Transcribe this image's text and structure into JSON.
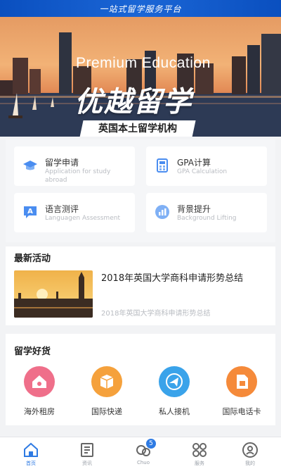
{
  "topbar": {
    "title": "一站式留学服务平台"
  },
  "hero": {
    "english_title": "Premium Education",
    "chinese_title": "优越留学",
    "plate_text": "英国本土留学机构"
  },
  "services": [
    {
      "title": "留学申请",
      "subtitle": "Application for study abroad",
      "icon": "graduation-cap-icon"
    },
    {
      "title": "GPA计算",
      "subtitle": "GPA Calculation",
      "icon": "calculator-icon"
    },
    {
      "title": "语言测评",
      "subtitle": "Languagen Assessment",
      "icon": "chat-a-icon"
    },
    {
      "title": "背景提升",
      "subtitle": "Background Lifting",
      "icon": "chart-icon"
    }
  ],
  "activities": {
    "title": "最新活动",
    "item": {
      "title": "2018年英国大学商科申请形势总结",
      "subtitle": "2018年英国大学商科申请形势总结"
    }
  },
  "goods": {
    "title": "留学好货",
    "items": [
      {
        "label": "海外租房",
        "icon": "house-icon",
        "color": "#ef6f8a"
      },
      {
        "label": "国际快递",
        "icon": "package-icon",
        "color": "#f5a13c"
      },
      {
        "label": "私人接机",
        "icon": "plane-icon",
        "color": "#3aa3ea"
      },
      {
        "label": "国际电话卡",
        "icon": "sim-card-icon",
        "color": "#f58a3a"
      }
    ]
  },
  "tabbar": {
    "items": [
      {
        "label": "首页",
        "icon": "home-icon",
        "active": true
      },
      {
        "label": "资讯",
        "icon": "news-icon",
        "active": false
      },
      {
        "label": "Chuo",
        "icon": "chat-icon",
        "active": false,
        "badge": "5"
      },
      {
        "label": "服务",
        "icon": "grid-icon",
        "active": false
      },
      {
        "label": "我的",
        "icon": "profile-icon",
        "active": false
      }
    ]
  },
  "colors": {
    "accent": "#2f7be3",
    "banner": "#0a4fbf"
  }
}
